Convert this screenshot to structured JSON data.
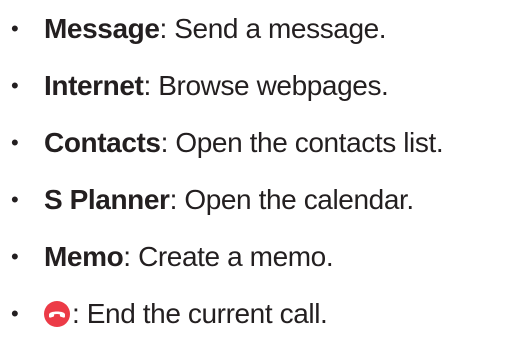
{
  "items": [
    {
      "bullet": "•",
      "term": "Message",
      "separator": ":",
      "description": " Send a message."
    },
    {
      "bullet": "•",
      "term": "Internet",
      "separator": ":",
      "description": " Browse webpages."
    },
    {
      "bullet": "•",
      "term": "Contacts",
      "separator": ":",
      "description": " Open the contacts list."
    },
    {
      "bullet": "•",
      "term": "S Planner",
      "separator": ":",
      "description": " Open the calendar."
    },
    {
      "bullet": "•",
      "term": "Memo",
      "separator": ":",
      "description": " Create a memo."
    },
    {
      "bullet": "•",
      "icon": "end-call-icon",
      "icon_color": "#ec3b47",
      "separator": ":",
      "description": " End the current call."
    }
  ]
}
